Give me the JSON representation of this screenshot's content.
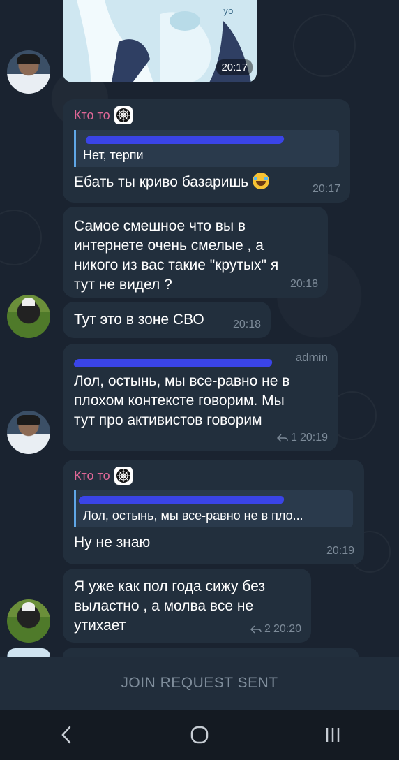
{
  "chat": {
    "sticker": {
      "time": "20:17"
    },
    "messages": [
      {
        "sender": "Кто то",
        "reply_text": "Нет, терпи",
        "text": "Ебать ты криво базаришь",
        "emoji": "face-with-tears-of-joy",
        "time": "20:17"
      },
      {
        "text_lines": [
          "Самое смешное что вы в",
          "интернете очень смелые , а",
          "никого из вас такие \"крутых\" я",
          "тут не видел ?"
        ],
        "time": "20:18"
      },
      {
        "text": "Тут это в зоне СВО",
        "time": "20:18"
      },
      {
        "role": "admin",
        "text_lines": [
          "Лол, остынь, мы все-равно не в",
          "плохом контексте говорим. Мы",
          "тут про активистов говорим"
        ],
        "replies": "1",
        "time": "20:19"
      },
      {
        "sender": "Кто то",
        "reply_text": "Лол, остынь, мы все-равно не в пло...",
        "text": "Ну не знаю",
        "time": "20:19"
      },
      {
        "text_lines": [
          "Я уже как пол года сижу без",
          "выластно , а молва все не",
          "утихает"
        ],
        "replies": "2",
        "time": "20:20"
      }
    ]
  },
  "bottom_bar": {
    "label": "JOIN REQUEST SENT"
  },
  "colors": {
    "background": "#1a2330",
    "bubble": "#222f3d",
    "sender_name": "#e06797",
    "reply_accent": "#5fa6e6",
    "meta": "#7d8b99",
    "scribble": "#3a44e8"
  },
  "icons": [
    "back-nav-icon",
    "home-nav-icon",
    "recents-nav-icon",
    "reply-arrow-icon",
    "spider-web-badge-icon"
  ]
}
